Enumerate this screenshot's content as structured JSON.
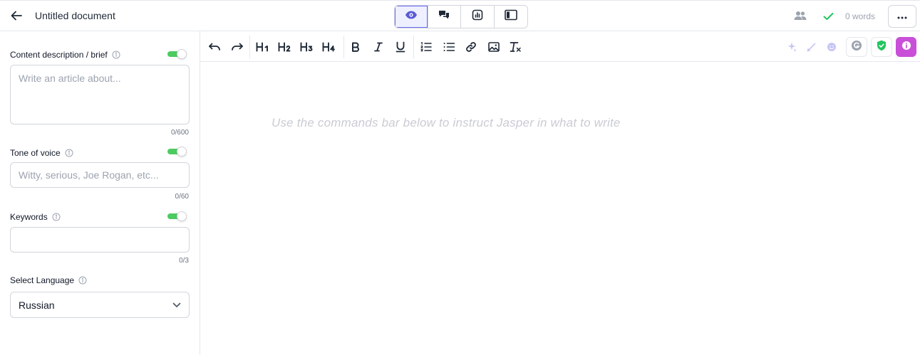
{
  "header": {
    "title": "Untitled document",
    "word_count": "0 words"
  },
  "sidebar": {
    "brief": {
      "label": "Content description / brief",
      "placeholder": "Write an article about...",
      "value": "",
      "counter": "0/600",
      "enabled": true
    },
    "tone": {
      "label": "Tone of voice",
      "placeholder": "Witty, serious, Joe Rogan, etc...",
      "value": "",
      "counter": "0/60",
      "enabled": true
    },
    "keywords": {
      "label": "Keywords",
      "placeholder": "",
      "value": "",
      "counter": "0/3",
      "enabled": true
    },
    "language": {
      "label": "Select Language",
      "value": "Russian"
    }
  },
  "editor": {
    "placeholder": "Use the commands bar below to instruct Jasper in what to write"
  },
  "colors": {
    "accent": "#5b5bd6",
    "toggle_on": "#4ccb5f",
    "info_button": "#c94fd8",
    "check": "#22c55e"
  }
}
